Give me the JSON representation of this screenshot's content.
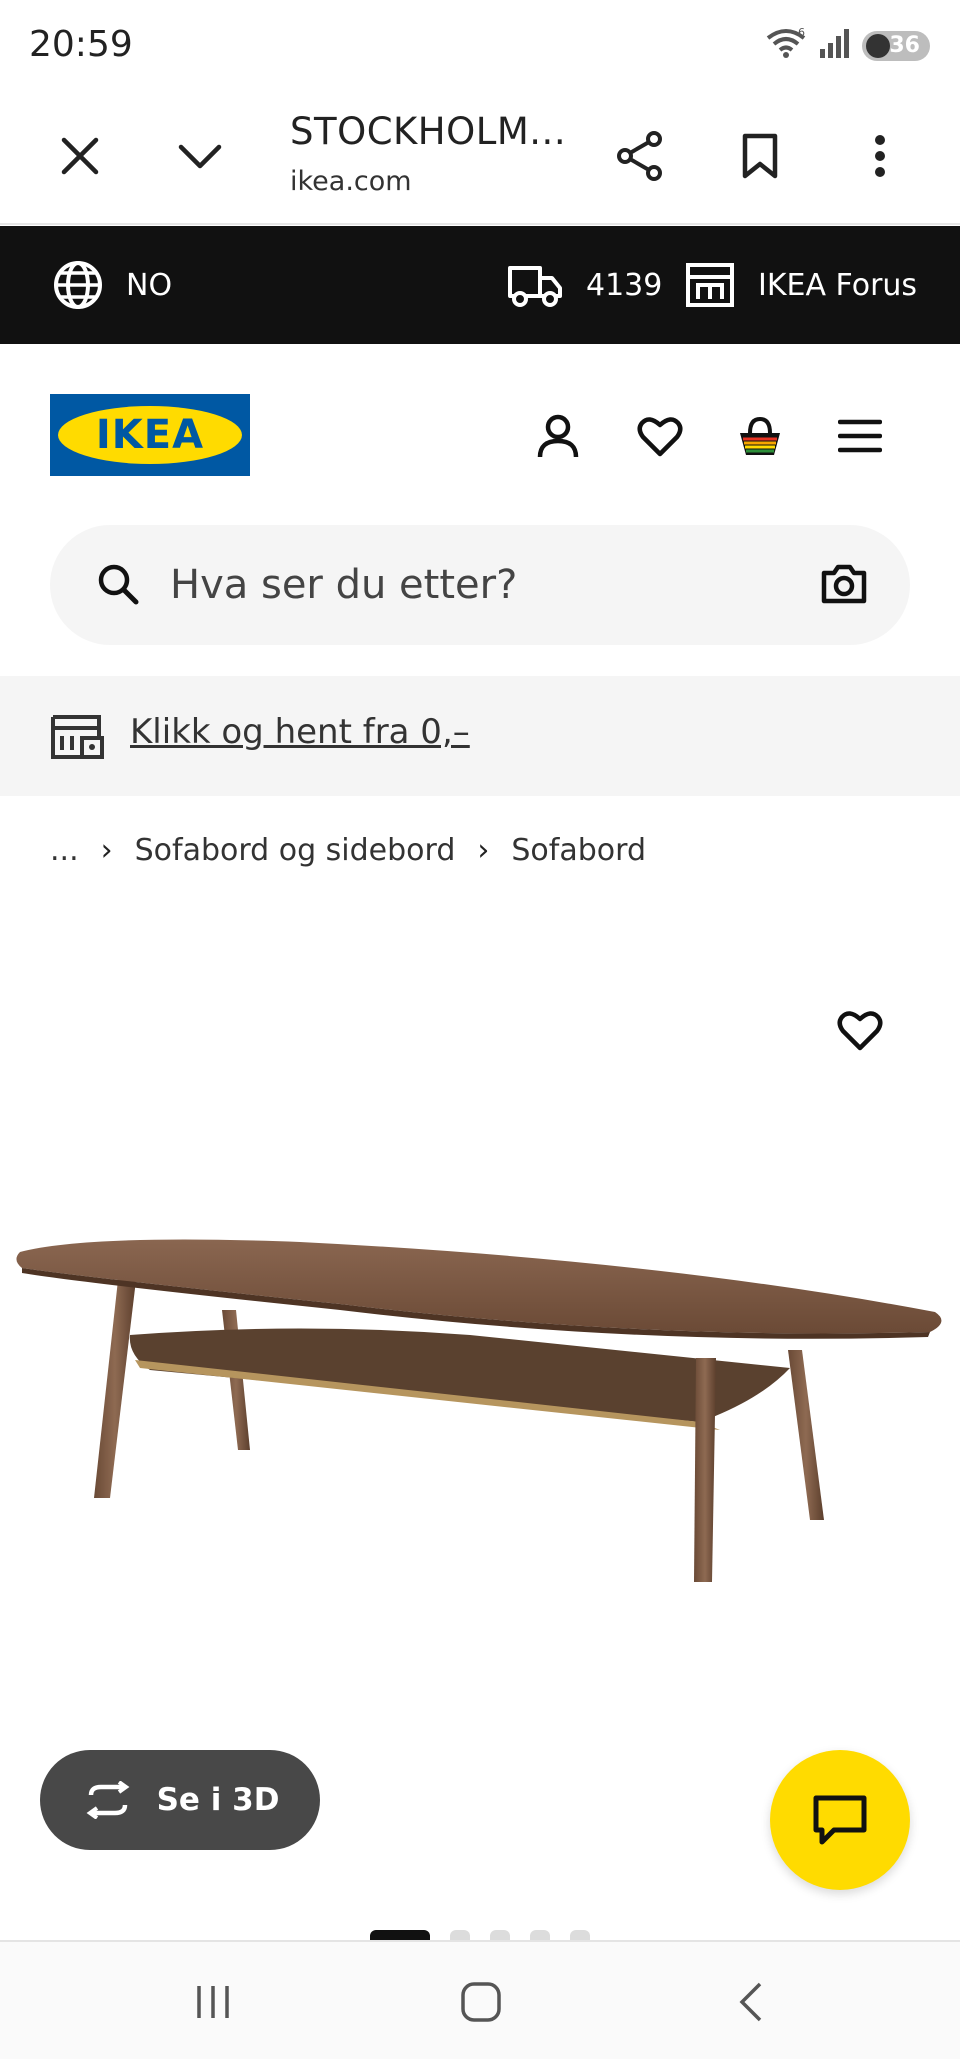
{
  "status_bar": {
    "time": "20:59",
    "battery": "36",
    "wifi_badge": "6"
  },
  "browser": {
    "title": "STOCKHOLM...",
    "url": "ikea.com",
    "icons": [
      "close-icon",
      "chevron-down-icon",
      "share-icon",
      "bookmark-icon",
      "more-vert-icon"
    ]
  },
  "top_strip": {
    "language": "NO",
    "postcode": "4139",
    "store": "IKEA Forus",
    "bg_color": "#111111"
  },
  "header": {
    "logo_text": "IKEA",
    "logo_colors": {
      "blue": "#0058a3",
      "yellow": "#ffdb00"
    },
    "icons": [
      "profile-icon",
      "heart-icon",
      "cart-icon",
      "menu-icon"
    ]
  },
  "search": {
    "placeholder": "Hva ser du etter?"
  },
  "promo": {
    "link_text": "Klikk og hent fra 0,–"
  },
  "breadcrumb": {
    "items": [
      "...",
      "Sofabord og sidebord",
      "Sofabord"
    ]
  },
  "product": {
    "view_3d_label": "Se i 3D",
    "image_count": 5,
    "active_image": 1,
    "accent_color": "#ffdb00"
  },
  "nav_bar": {
    "icons": [
      "recent-apps-icon",
      "home-icon",
      "back-icon"
    ]
  }
}
